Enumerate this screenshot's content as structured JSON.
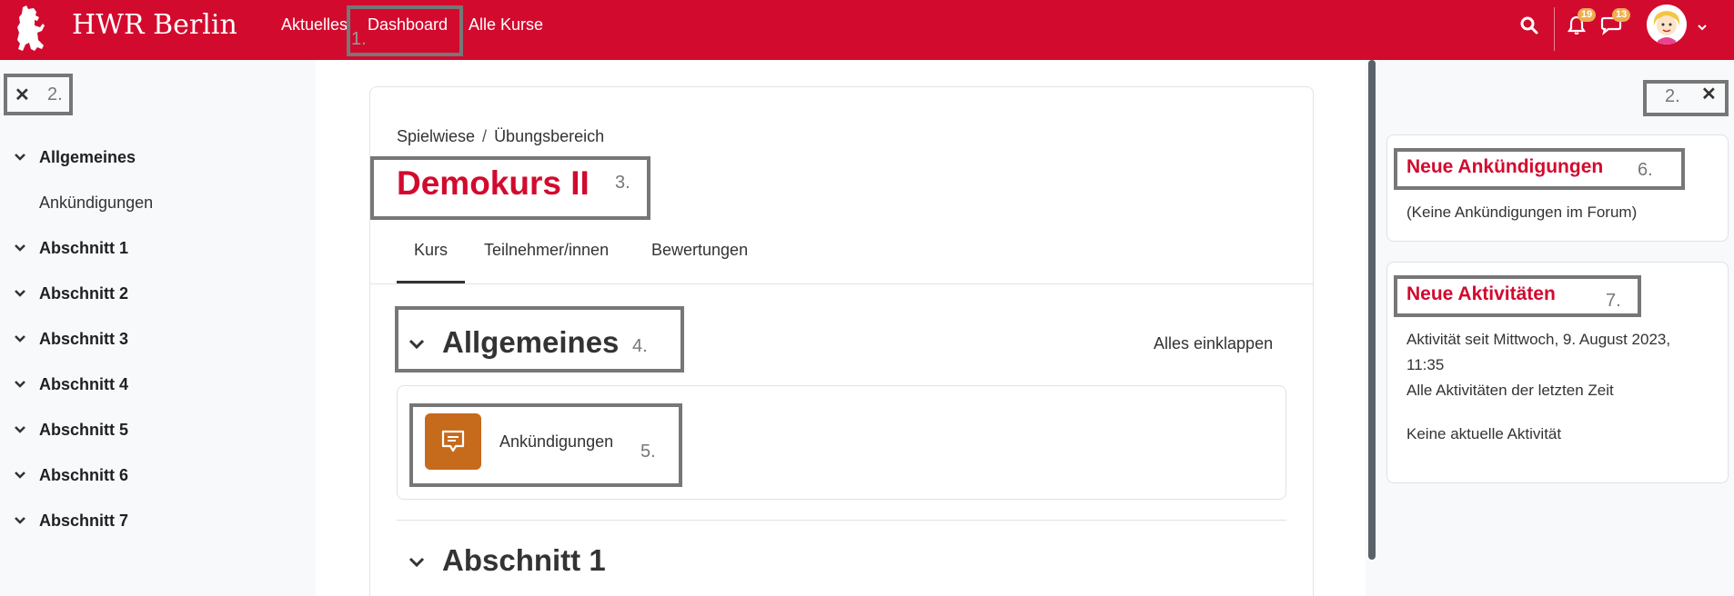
{
  "header": {
    "brand": "HWR Berlin",
    "nav": [
      "Aktuelles",
      "Dashboard",
      "Alle Kurse"
    ],
    "notifications_count": "19",
    "messages_count": "13"
  },
  "annotations": {
    "n1": "1.",
    "n2_left": "2.",
    "n2_right": "2.",
    "n3": "3.",
    "n4": "4.",
    "n5": "5.",
    "n6": "6.",
    "n7": "7."
  },
  "course_index": {
    "items": [
      {
        "label": "Allgemeines",
        "sub": "Ankündigungen"
      },
      {
        "label": "Abschnitt 1"
      },
      {
        "label": "Abschnitt 2"
      },
      {
        "label": "Abschnitt 3"
      },
      {
        "label": "Abschnitt 4"
      },
      {
        "label": "Abschnitt 5"
      },
      {
        "label": "Abschnitt 6"
      },
      {
        "label": "Abschnitt 7"
      }
    ]
  },
  "main": {
    "breadcrumb": [
      "Spielwiese",
      "Übungsbereich"
    ],
    "breadcrumb_sep": "/",
    "title": "Demokurs II",
    "tabs": [
      "Kurs",
      "Teilnehmer/innen",
      "Bewertungen"
    ],
    "section1": "Allgemeines",
    "collapse_all": "Alles einklappen",
    "activity": "Ankündigungen",
    "section2": "Abschnitt 1"
  },
  "blocks": {
    "news": {
      "title": "Neue Ankündigungen",
      "text": "(Keine Ankündigungen im Forum)"
    },
    "recent": {
      "title": "Neue Aktivitäten",
      "line1": "Aktivität seit Mittwoch, 9. August 2023,",
      "line2": "11:35",
      "line3": "Alle Aktivitäten der letzten Zeit",
      "line4": "Keine aktuelle Aktivität"
    }
  },
  "colors": {
    "brand": "#d20a2e",
    "forum_icon": "#c66a1b",
    "annotation_box": "#777777",
    "badge": "#f0ad4e"
  },
  "icons": [
    "bear-logo-icon",
    "search-icon",
    "bell-icon",
    "chat-icon",
    "avatar",
    "chevron-down-icon",
    "close-icon",
    "forum-icon"
  ]
}
